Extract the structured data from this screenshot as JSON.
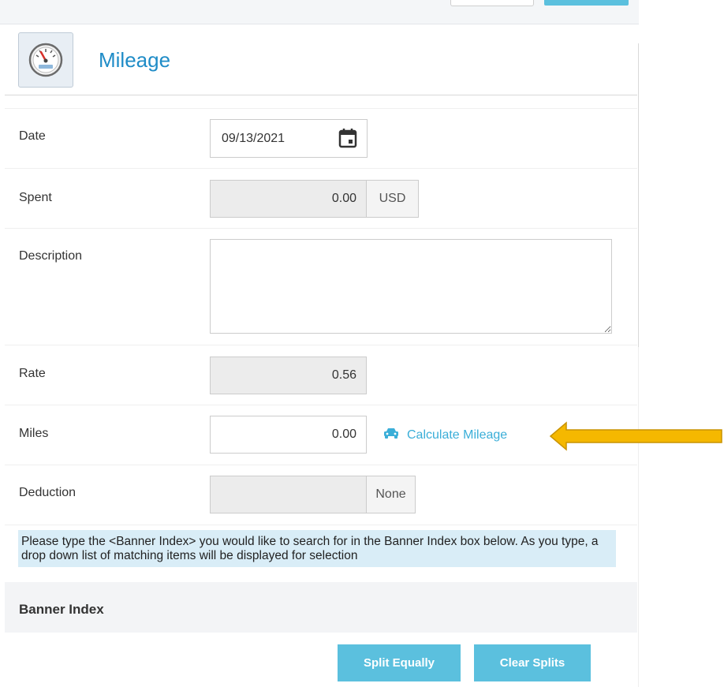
{
  "header": {
    "title": "Mileage",
    "icon": "speedometer-icon"
  },
  "form": {
    "date": {
      "label": "Date",
      "value": "09/13/2021"
    },
    "spent": {
      "label": "Spent",
      "value": "0.00",
      "currency": "USD"
    },
    "description": {
      "label": "Description",
      "value": ""
    },
    "rate": {
      "label": "Rate",
      "value": "0.56"
    },
    "miles": {
      "label": "Miles",
      "value": "0.00",
      "calculate_link": "Calculate Mileage"
    },
    "deduction": {
      "label": "Deduction",
      "value": "",
      "addon": "None"
    }
  },
  "info": {
    "message": "Please type the <Banner Index> you would like to search for in the Banner Index box below. As you type, a drop down list of matching items will be displayed for selection"
  },
  "banner": {
    "title": "Banner Index"
  },
  "buttons": {
    "split_equally": "Split Equally",
    "clear_splits": "Clear Splits"
  },
  "colors": {
    "accent": "#1f8cc7",
    "link": "#3aaed8",
    "button": "#5bc0de",
    "arrow": "#f5b800",
    "info_bg": "#d9edf7"
  }
}
